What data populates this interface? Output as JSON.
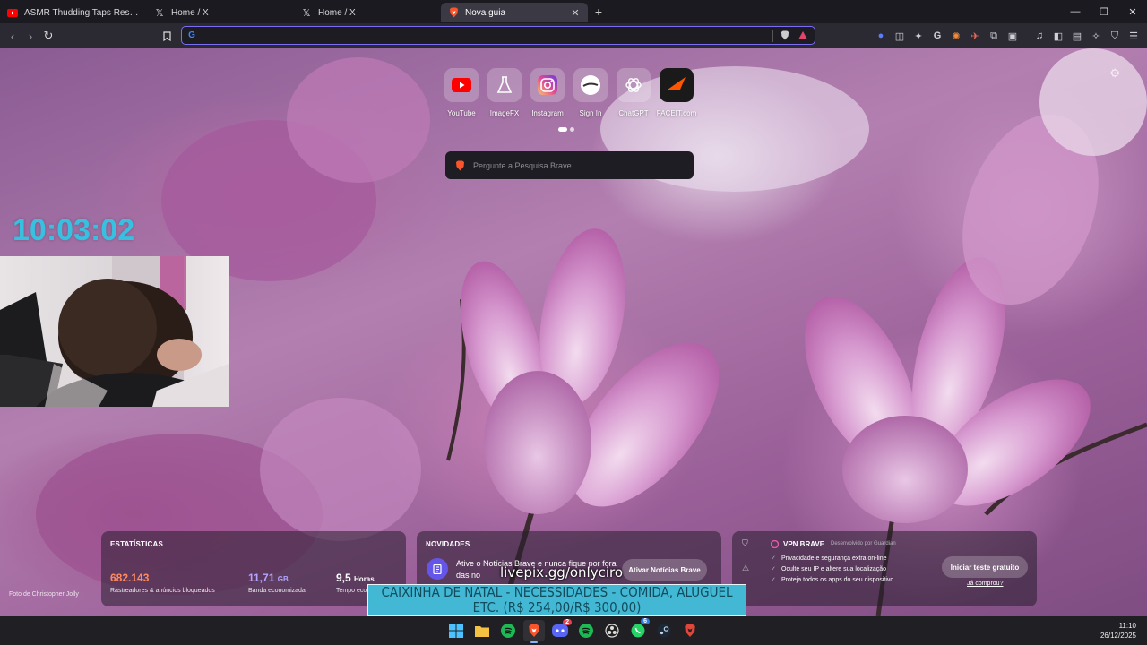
{
  "tabs": [
    {
      "title": "ASMR Thudding Taps Resonating in",
      "favicon": "youtube-icon",
      "active": false
    },
    {
      "title": "Home / X",
      "favicon": "x-icon",
      "active": false
    },
    {
      "title": "Home / X",
      "favicon": "x-icon",
      "active": false
    },
    {
      "title": "Nova guia",
      "favicon": "brave-icon",
      "active": true
    }
  ],
  "urlbar": {
    "value": "",
    "placeholder": ""
  },
  "top_sites": [
    {
      "label": "YouTube",
      "icon": "youtube-icon"
    },
    {
      "label": "ImageFX",
      "icon": "flask-icon"
    },
    {
      "label": "Instagram",
      "icon": "instagram-icon"
    },
    {
      "label": "Sign In",
      "icon": "signin-icon"
    },
    {
      "label": "ChatGPT",
      "icon": "chatgpt-icon"
    },
    {
      "label": "FACEIT.com",
      "icon": "faceit-icon"
    }
  ],
  "search": {
    "placeholder": "Pergunte a Pesquisa Brave"
  },
  "clock": "10:03:02",
  "photo_credit": "Foto de Christopher Jolly",
  "stats": {
    "heading": "ESTATÍSTICAS",
    "trackers": {
      "value": "682.143",
      "desc": "Rastreadores & anúncios bloqueados"
    },
    "bandwidth": {
      "value": "11,71",
      "unit": "GB",
      "desc": "Banda economizada"
    },
    "time": {
      "value": "9,5",
      "unit": "Horas",
      "desc": "Tempo economizado"
    }
  },
  "news": {
    "heading": "NOVIDADES",
    "text": "Ative o Notícias Brave e nunca fique por fora das no",
    "button": "Ativar Notícias Brave"
  },
  "vpn": {
    "title": "VPN BRAVE",
    "developed_by": "Desenvolvido por Guardian",
    "features": [
      "Privacidade e segurança extra on-line",
      "Oculte seu IP e altere sua localização",
      "Proteja todos os apps do seu dispositivo"
    ],
    "button": "Iniciar teste gratuito",
    "link": "Já comprou?"
  },
  "overlay": {
    "link": "livepix.gg/onlyciro",
    "banner": "CAIXINHA DE NATAL - NECESSIDADES - COMIDA, ALUGUEL ETC. (R$ 254,00/R$ 300,00)"
  },
  "taskbar": {
    "time": "11:10",
    "date": "26/12/2025",
    "discord_badge": "2",
    "whatsapp_badge": "6"
  },
  "colors": {
    "accent": "#7b6cf6",
    "clock": "#38c0e0",
    "banner": "#42b8d4",
    "brave": "#fb542b"
  }
}
